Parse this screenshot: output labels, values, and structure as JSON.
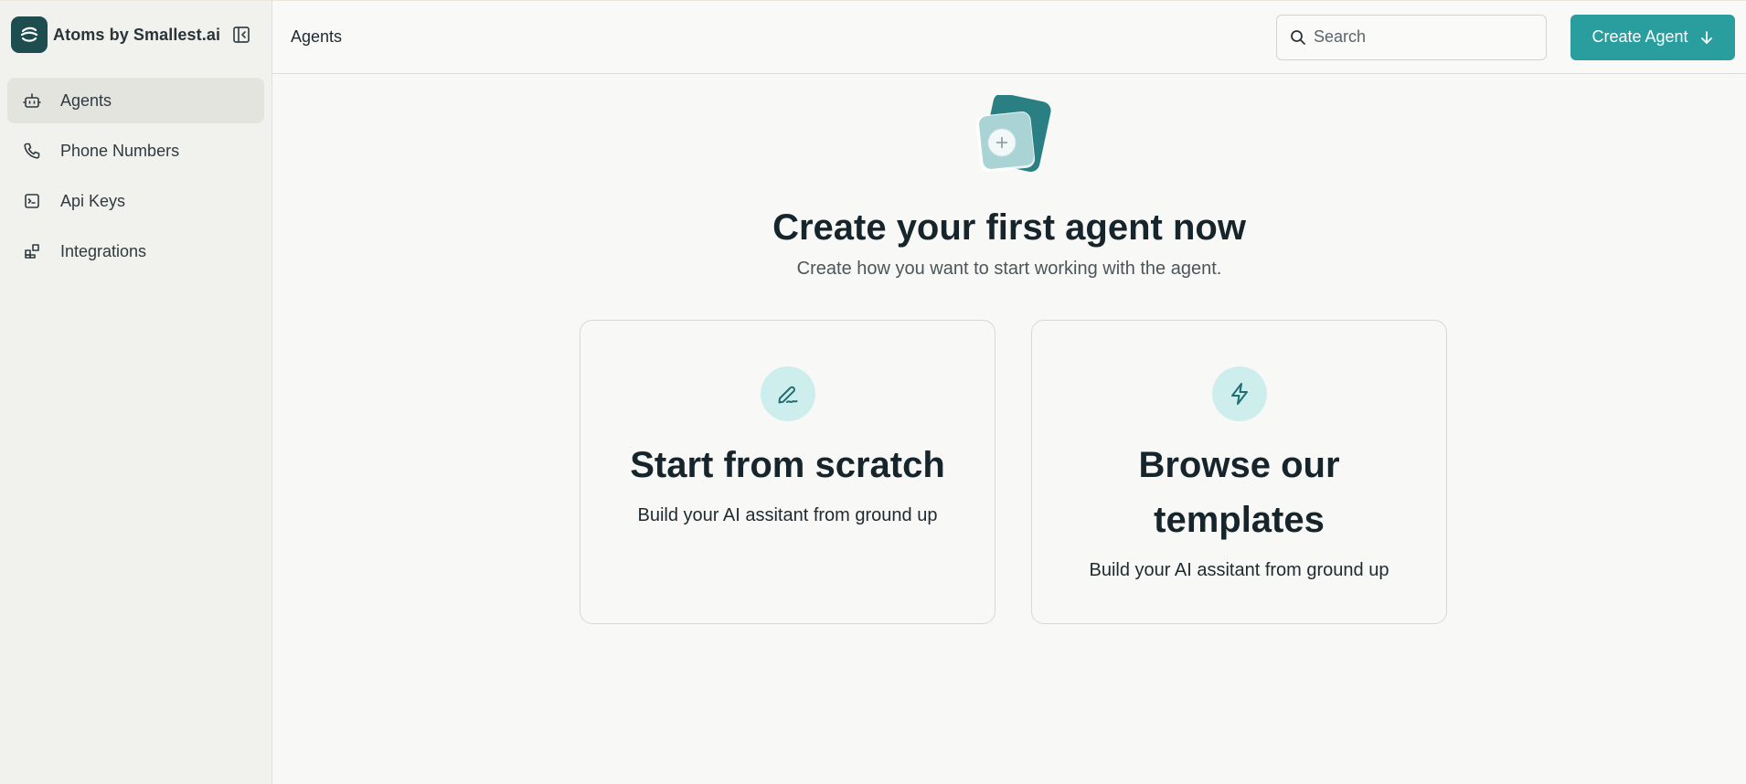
{
  "brand": {
    "name": "Atoms by Smallest.ai",
    "logo_icon": "smallest-logo-icon"
  },
  "sidebar": {
    "items": [
      {
        "label": "Agents",
        "icon": "robot-icon",
        "active": true
      },
      {
        "label": "Phone Numbers",
        "icon": "phone-icon",
        "active": false
      },
      {
        "label": "Api Keys",
        "icon": "terminal-icon",
        "active": false
      },
      {
        "label": "Integrations",
        "icon": "blocks-icon",
        "active": false
      }
    ]
  },
  "header": {
    "breadcrumb": "Agents",
    "search_placeholder": "Search",
    "search_value": "",
    "create_label": "Create Agent"
  },
  "main": {
    "title": "Create your first agent now",
    "subtitle": "Create how you want to start working with the agent.",
    "cards": [
      {
        "title": "Start from scratch",
        "description": "Build your AI assitant from ground up",
        "icon": "pen-icon"
      },
      {
        "title": "Browse our templates",
        "description": "Build your AI assitant from ground up",
        "icon": "lightning-icon"
      }
    ]
  },
  "colors": {
    "accent": "#2a9d9f",
    "brand_dark": "#1d4d4f",
    "icon_bg": "#cdeeed",
    "sidebar_bg": "#f1f1ed",
    "page_bg": "#f8f8f6"
  }
}
